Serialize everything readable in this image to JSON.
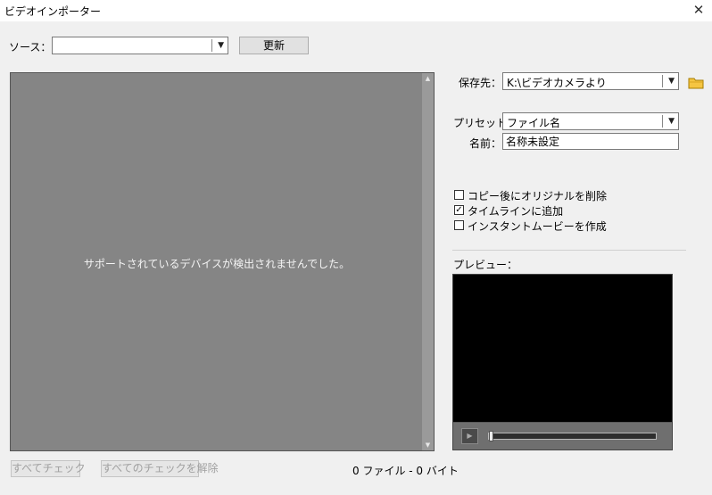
{
  "window": {
    "title": "ビデオインポーター"
  },
  "source": {
    "label": "ソース：",
    "value": "",
    "refresh_label": "更新"
  },
  "source_panel": {
    "message": "サポートされているデバイスが検出されませんでした。"
  },
  "bottom": {
    "check_all": "すべてチェック",
    "uncheck_all": "すべてのチェックを解除",
    "status": "0 ファイル - 0 バイト"
  },
  "save": {
    "label": "保存先：",
    "value": "K:\\ビデオカメラより"
  },
  "preset": {
    "label": "プリセット：",
    "value": "ファイル名"
  },
  "name": {
    "label": "名前：",
    "value": "名称未設定"
  },
  "options": [
    {
      "label": "コピー後にオリジナルを削除",
      "checked": false
    },
    {
      "label": "タイムラインに追加",
      "checked": true
    },
    {
      "label": "インスタントムービーを作成",
      "checked": false
    }
  ],
  "preview": {
    "label": "プレビュー：",
    "playback_position": 0
  },
  "icons": {
    "close": "close-icon",
    "dropdown": "chevron-down-icon",
    "folder": "folder-icon",
    "play": "play-icon",
    "checkmark": "checkmark-icon"
  },
  "colors": {
    "window_bg": "#f0f0f0",
    "source_panel_bg": "#858585",
    "preview_bg": "#000000",
    "folder_icon": "#f5c542"
  }
}
